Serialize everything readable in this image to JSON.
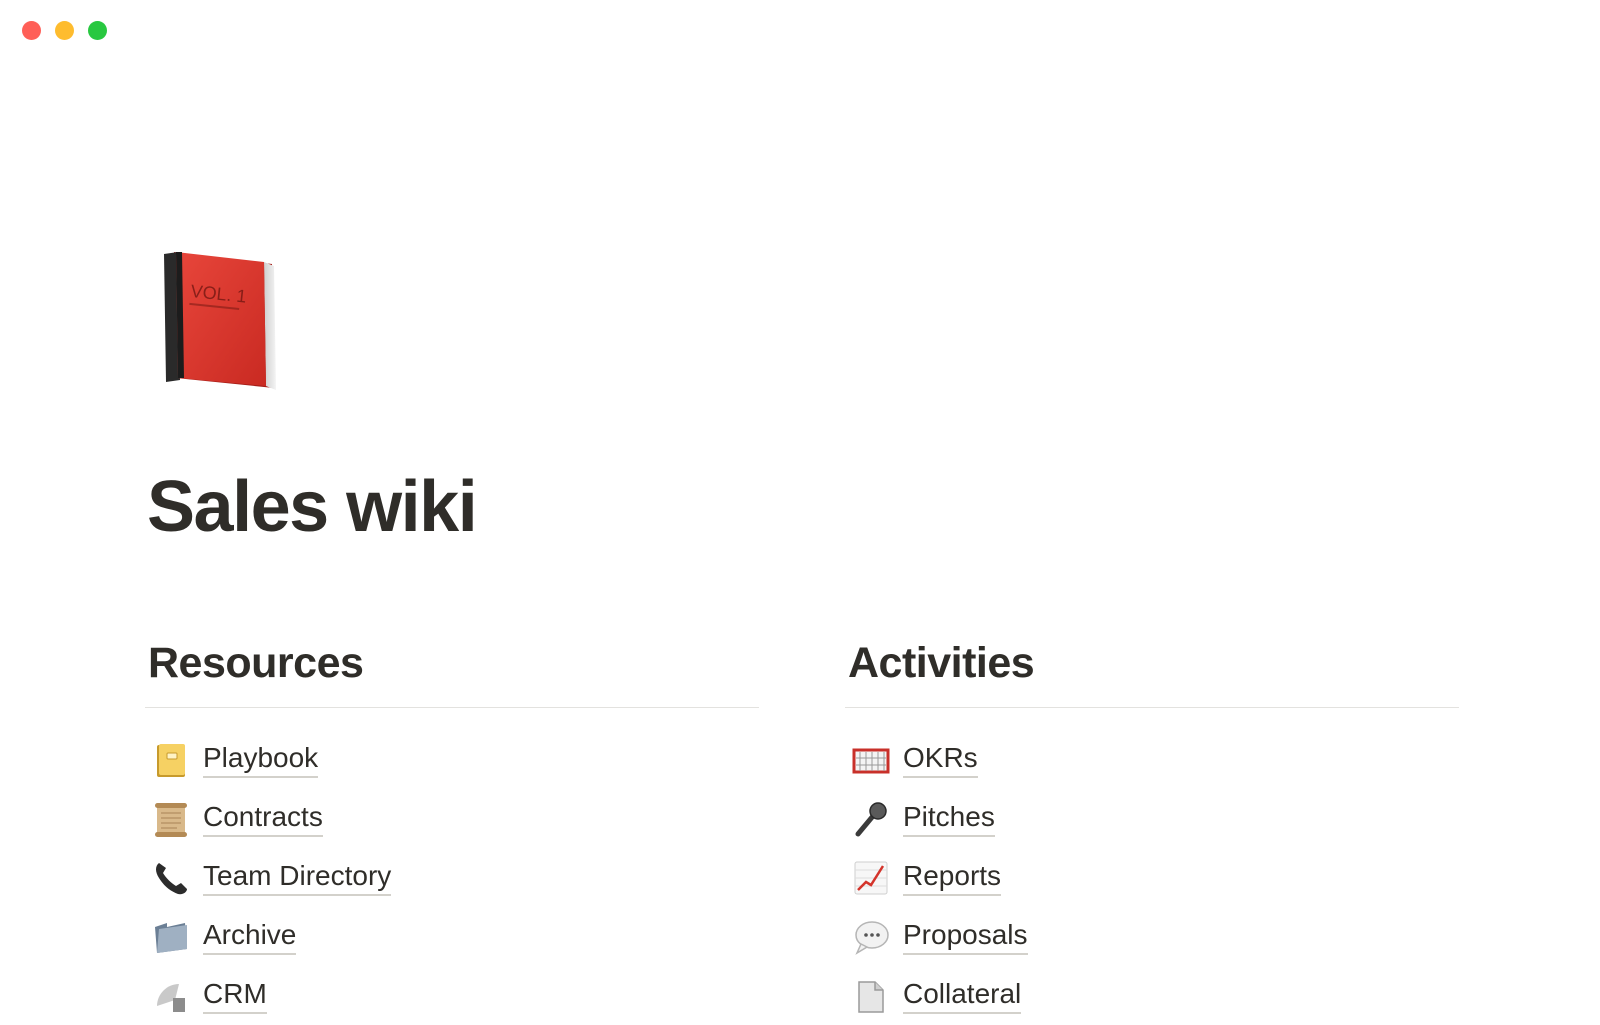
{
  "page": {
    "title": "Sales wiki"
  },
  "resources": {
    "heading": "Resources",
    "items": [
      {
        "label": "Playbook",
        "icon": "notebook-icon"
      },
      {
        "label": "Contracts",
        "icon": "scroll-icon"
      },
      {
        "label": "Team Directory",
        "icon": "telephone-icon"
      },
      {
        "label": "Archive",
        "icon": "folder-icon"
      },
      {
        "label": "CRM",
        "icon": "satellite-icon"
      }
    ]
  },
  "activities": {
    "heading": "Activities",
    "items": [
      {
        "label": "OKRs",
        "icon": "goal-net-icon"
      },
      {
        "label": "Pitches",
        "icon": "microphone-icon"
      },
      {
        "label": "Reports",
        "icon": "chart-increasing-icon"
      },
      {
        "label": "Proposals",
        "icon": "speech-balloon-icon"
      },
      {
        "label": "Collateral",
        "icon": "document-icon"
      }
    ]
  },
  "colors": {
    "text": "#37352f",
    "divider": "#e3e2df",
    "underline": "#d3d1cb"
  }
}
